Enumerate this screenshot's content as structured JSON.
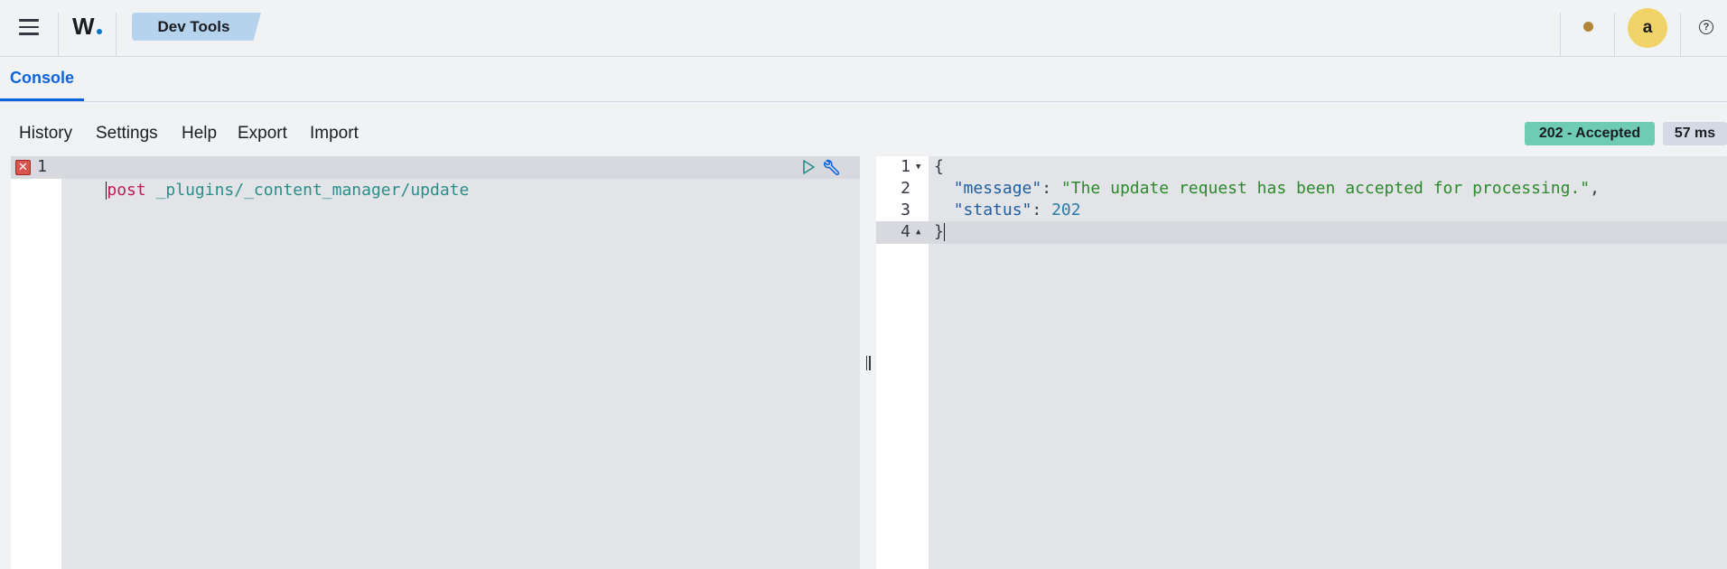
{
  "header": {
    "logo_text": "W",
    "breadcrumb": "Dev Tools",
    "avatar_initial": "a",
    "help_glyph": "?",
    "icons": [
      "menu-icon",
      "notification-dot-icon",
      "help-icon"
    ]
  },
  "tabs": [
    {
      "label": "Console",
      "active": true
    }
  ],
  "toolbar": {
    "history": "History",
    "settings": "Settings",
    "help": "Help",
    "export": "Export",
    "import": "Import",
    "status": "202 - Accepted",
    "time": "57 ms"
  },
  "request_editor": {
    "line_numbers": [
      "1"
    ],
    "method": "post",
    "url": "_plugins/_content_manager/update",
    "error_glyph": "✕",
    "icons": [
      "error-marker-icon",
      "run-icon",
      "wrench-icon"
    ]
  },
  "response_editor": {
    "line_numbers": [
      "1",
      "2",
      "3",
      "4"
    ],
    "line1": "{",
    "line2_key": "\"message\"",
    "line2_sep": ": ",
    "line2_value": "\"The update request has been accepted for processing.\"",
    "line2_trail": ",",
    "line3_key": "\"status\"",
    "line3_sep": ": ",
    "line3_value": "202",
    "line4": "}"
  },
  "colors": {
    "accent": "#0b64dd",
    "status_success": "#6dccb1",
    "method": "#bd1b58",
    "url": "#2a8d88",
    "string": "#2b8a2b"
  }
}
